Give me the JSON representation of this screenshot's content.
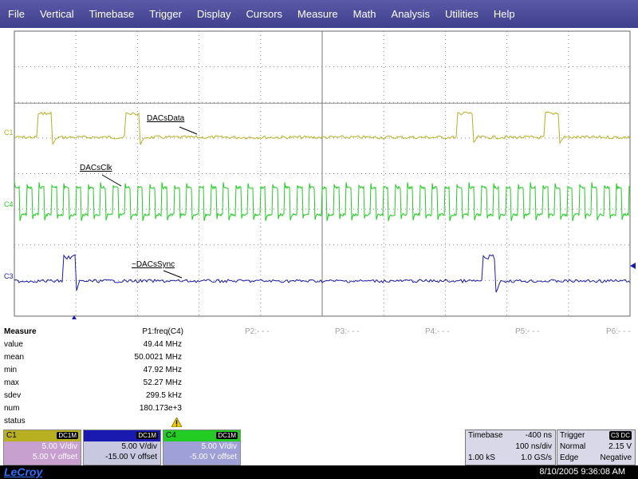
{
  "menu": [
    "File",
    "Vertical",
    "Timebase",
    "Trigger",
    "Display",
    "Cursors",
    "Measure",
    "Math",
    "Analysis",
    "Utilities",
    "Help"
  ],
  "channels": {
    "c1": {
      "label": "C1",
      "trace_name": "DACsData",
      "color": "#b8b020"
    },
    "c4": {
      "label": "C4",
      "trace_name": "DACsClk",
      "color": "#22cc22"
    },
    "c3": {
      "label": "C3",
      "trace_name": "~DACsSync",
      "color": "#1a1ab0"
    }
  },
  "measure": {
    "title": "Measure",
    "p1_label": "P1:freq(C4)",
    "rows": [
      {
        "name": "value",
        "value": "49.44 MHz"
      },
      {
        "name": "mean",
        "value": "50.0021 MHz"
      },
      {
        "name": "min",
        "value": "47.92 MHz"
      },
      {
        "name": "max",
        "value": "52.27 MHz"
      },
      {
        "name": "sdev",
        "value": "299.5 kHz"
      },
      {
        "name": "num",
        "value": "180.173e+3"
      },
      {
        "name": "status",
        "value": ""
      }
    ],
    "params": [
      "P2:- - -",
      "P3:- - -",
      "P4:- - -",
      "P5:- - -",
      "P6:- - -"
    ]
  },
  "channel_boxes": [
    {
      "name": "C1",
      "coupling": "DC1M",
      "vdiv": "5.00 V/div",
      "offset": "5.00 V offset",
      "bg": "#c8a0d0",
      "hdr": "#b8b020"
    },
    {
      "name": "",
      "coupling": "DC1M",
      "vdiv": "5.00 V/div",
      "offset": "-15.00 V offset",
      "bg": "#6a6ad0",
      "hdr": "#1a1ab0"
    },
    {
      "name": "C4",
      "coupling": "DC1M",
      "vdiv": "5.00 V/div",
      "offset": "-5.00 V offset",
      "bg": "#9a9ad8",
      "hdr": "#22cc22"
    }
  ],
  "timebase": {
    "title": "Timebase",
    "delay": "-400 ns",
    "tdiv": "100 ns/div",
    "samples": "1.00 kS",
    "rate": "1.0 GS/s"
  },
  "trigger": {
    "title": "Trigger",
    "source": "C3 DC",
    "mode": "Normal",
    "level": "2.15 V",
    "type": "Edge",
    "slope": "Negative"
  },
  "footer": {
    "brand": "LeCroy",
    "timestamp": "8/10/2005 9:36:08 AM"
  }
}
